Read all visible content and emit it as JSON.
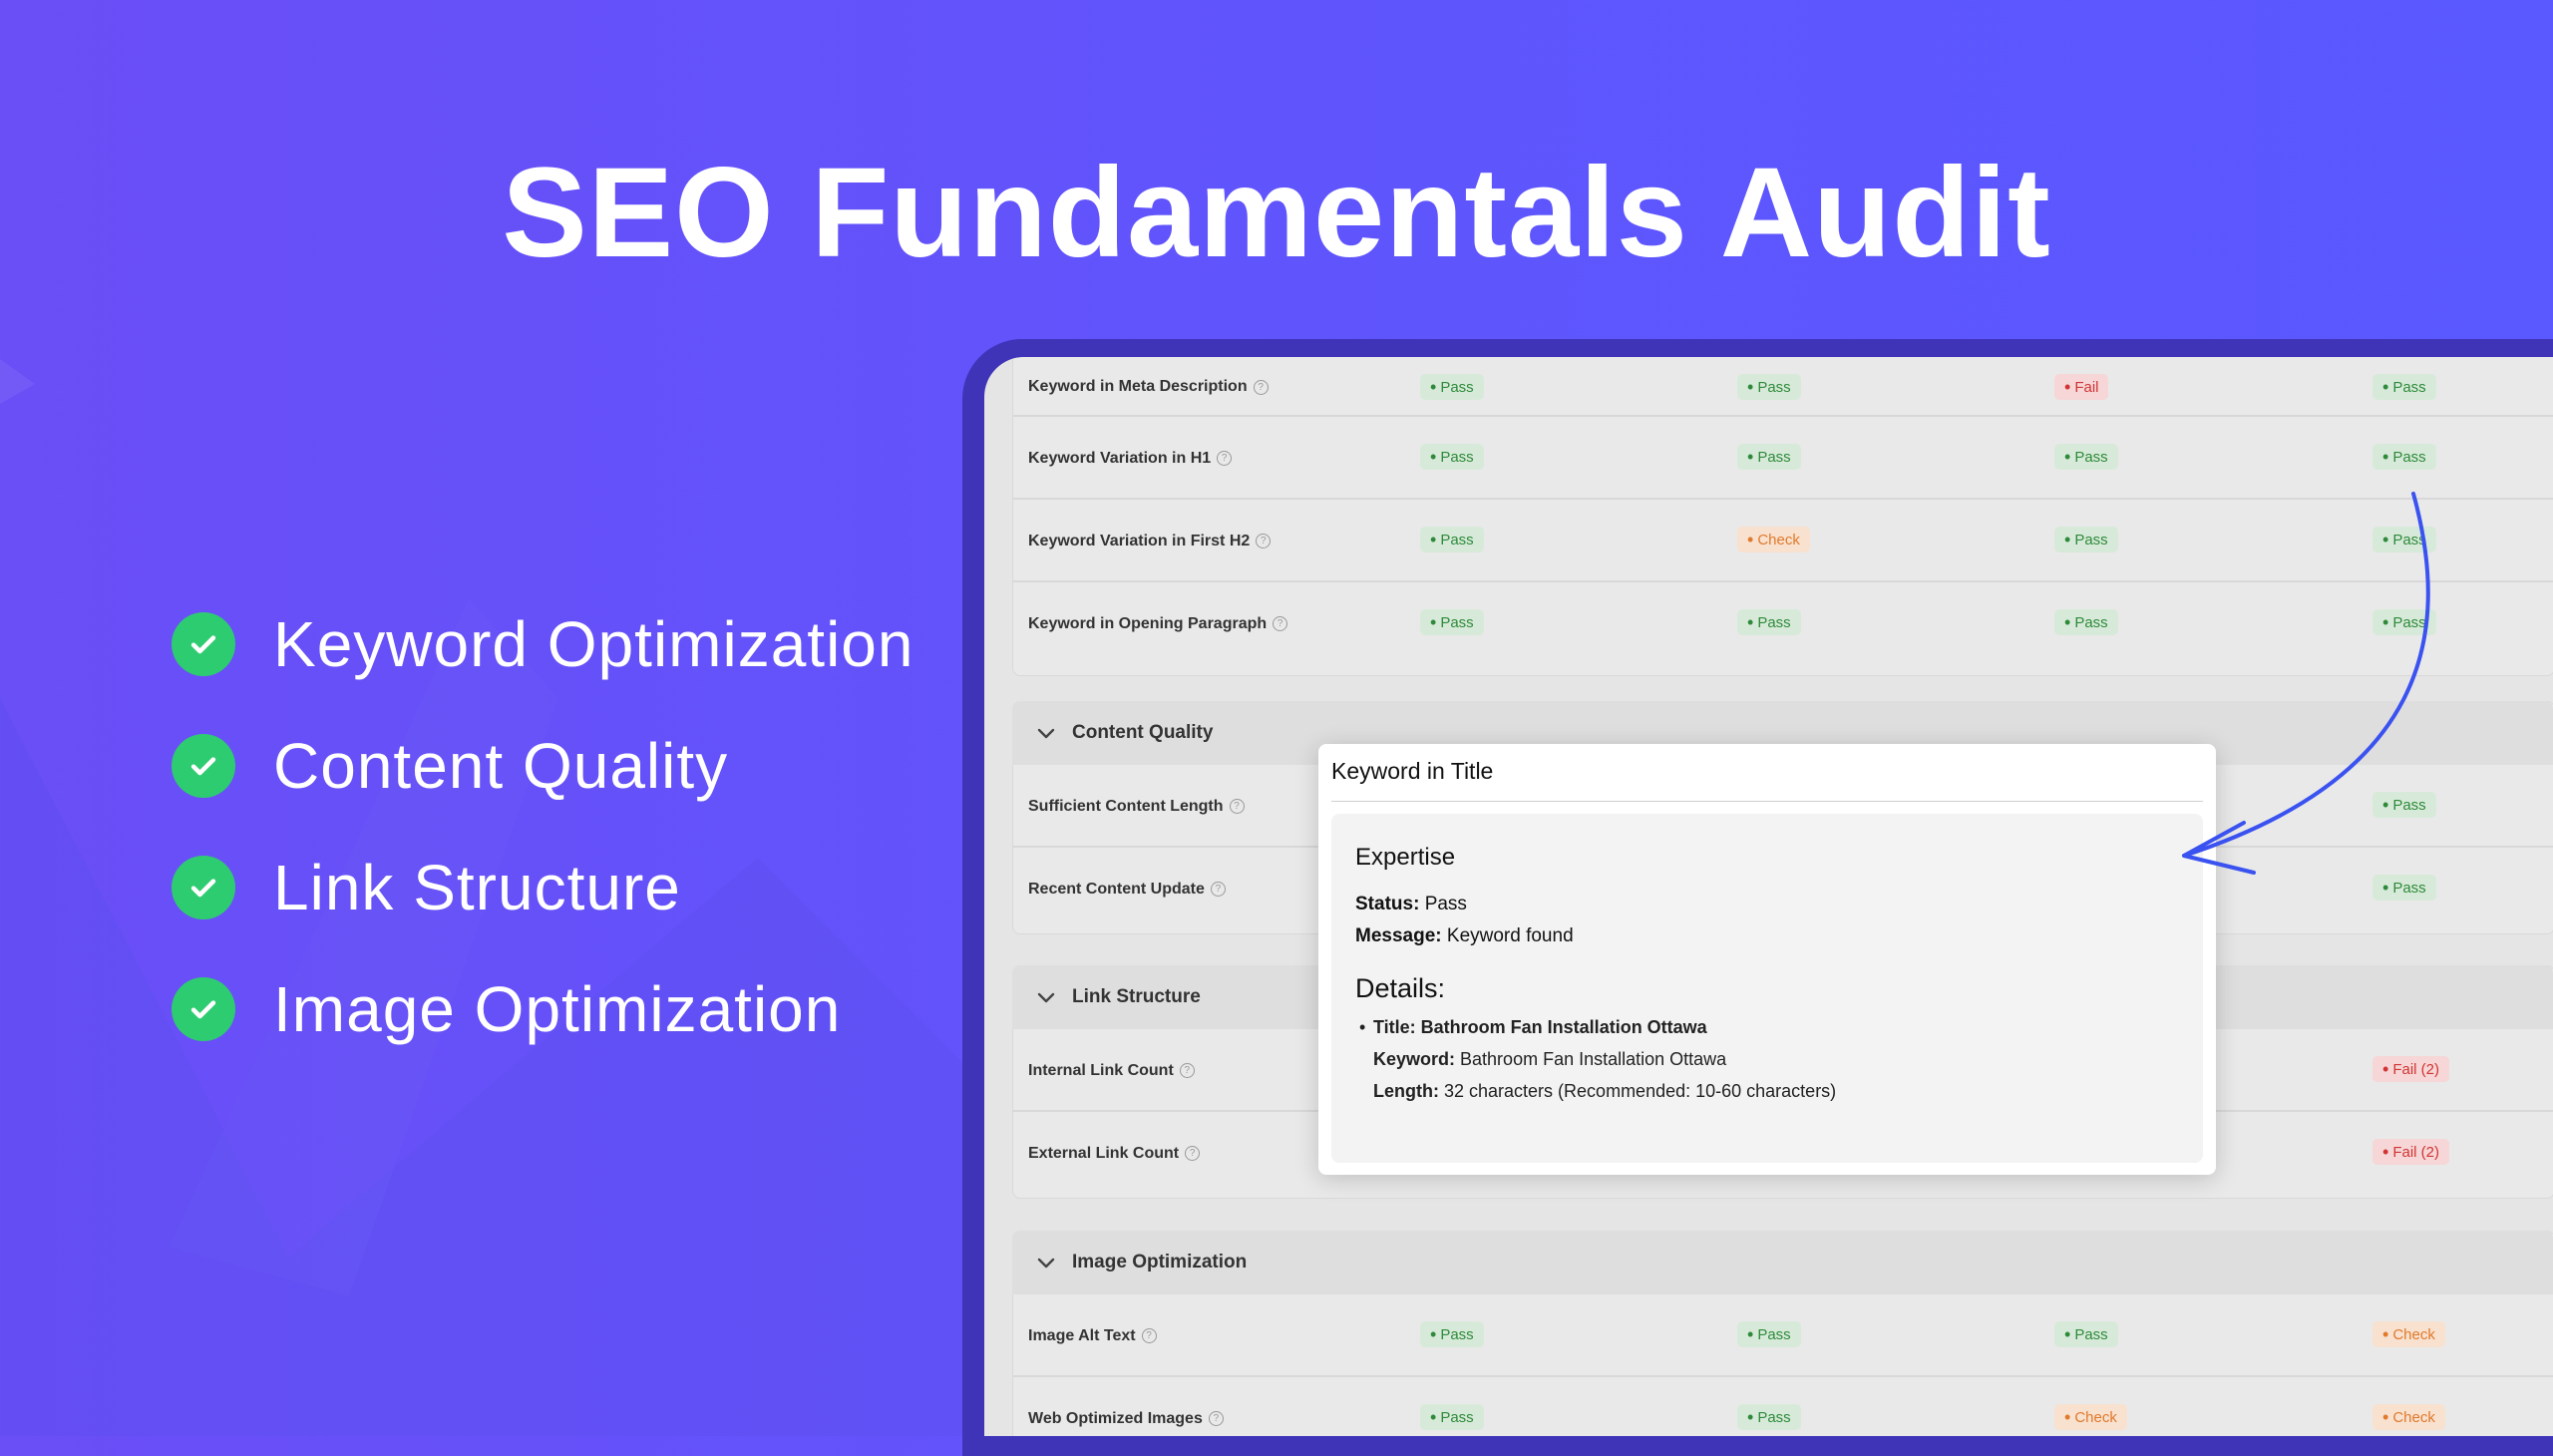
{
  "page": {
    "title": "SEO Fundamentals Audit",
    "accent": "#2ecc71",
    "background": "#5f55fd"
  },
  "features": [
    {
      "label": "Keyword Optimization",
      "icon": "check-circle-icon"
    },
    {
      "label": "Content Quality",
      "icon": "check-circle-icon"
    },
    {
      "label": "Link Structure",
      "icon": "check-circle-icon"
    },
    {
      "label": "Image Optimization",
      "icon": "check-circle-icon"
    }
  ],
  "table": {
    "help_glyph": "?",
    "keyword_rows": [
      {
        "label": "Keyword in Meta Description",
        "statuses": [
          "Pass",
          "Pass",
          "Fail",
          "Pass"
        ]
      },
      {
        "label": "Keyword Variation in H1",
        "statuses": [
          "Pass",
          "Pass",
          "Pass",
          "Pass"
        ]
      },
      {
        "label": "Keyword Variation in First H2",
        "statuses": [
          "Pass",
          "Check",
          "Pass",
          "Pass"
        ]
      },
      {
        "label": "Keyword in Opening Paragraph",
        "statuses": [
          "Pass",
          "Pass",
          "Pass",
          "Pass"
        ]
      }
    ],
    "sections": [
      {
        "title": "Content Quality",
        "rows": [
          {
            "label": "Sufficient Content Length",
            "statuses": [
              "",
              "",
              "",
              "Pass"
            ]
          },
          {
            "label": "Recent Content Update",
            "statuses": [
              "",
              "",
              "",
              "Pass"
            ]
          }
        ]
      },
      {
        "title": "Link Structure",
        "rows": [
          {
            "label": "Internal Link Count",
            "statuses": [
              "",
              "",
              "",
              "Fail (2)"
            ]
          },
          {
            "label": "External Link Count",
            "statuses": [
              "",
              "",
              "",
              "Fail (2)"
            ]
          }
        ]
      },
      {
        "title": "Image Optimization",
        "rows": [
          {
            "label": "Image Alt Text",
            "statuses": [
              "Pass",
              "Pass",
              "Pass",
              "Check"
            ]
          },
          {
            "label": "Web Optimized Images",
            "statuses": [
              "Pass",
              "Pass",
              "Check",
              "Check"
            ]
          }
        ]
      }
    ]
  },
  "popup": {
    "title": "Keyword in Title",
    "heading": "Expertise",
    "status_label": "Status:",
    "status_value": "Pass",
    "message_label": "Message:",
    "message_value": "Keyword found",
    "details_heading": "Details:",
    "detail_title": "Title: Bathroom Fan Installation Ottawa",
    "keyword_label": "Keyword:",
    "keyword_value": "Bathroom Fan Installation Ottawa",
    "length_label": "Length:",
    "length_value": "32 characters (Recommended: 10-60 characters)"
  }
}
